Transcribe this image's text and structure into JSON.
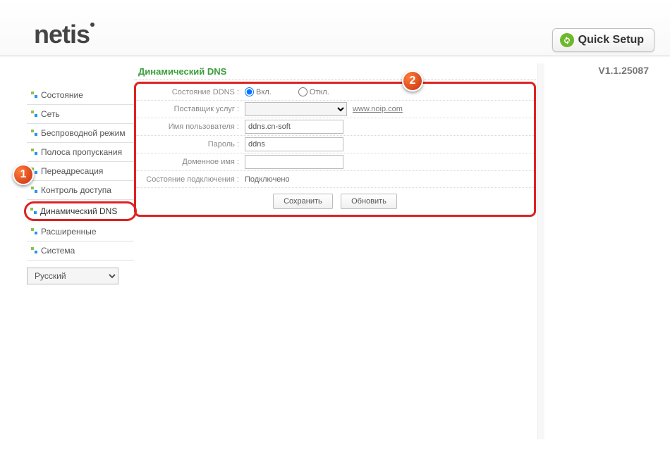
{
  "header": {
    "logo_text": "netis",
    "quick_setup": "Quick Setup"
  },
  "version": "V1.1.25087",
  "sidebar": {
    "items": [
      {
        "label": "Состояние"
      },
      {
        "label": "Сеть"
      },
      {
        "label": "Беспроводной режим"
      },
      {
        "label": "Полоса пропускания"
      },
      {
        "label": "Переадресация"
      },
      {
        "label": "Контроль доступа"
      },
      {
        "label": "Динамический DNS"
      },
      {
        "label": "Расширенные"
      },
      {
        "label": "Система"
      }
    ],
    "language": "Русский"
  },
  "form": {
    "title": "Динамический DNS",
    "labels": {
      "status": "Состояние DDNS :",
      "provider": "Поставщик услуг :",
      "username": "Имя пользователя :",
      "password": "Пароль :",
      "domain": "Доменное имя :",
      "conn_status": "Состояние подключения :"
    },
    "radio": {
      "on": "Вкл.",
      "off": "Откл."
    },
    "provider_link": "www.noip.com",
    "values": {
      "username": "ddns.cn-soft",
      "password": "ddns",
      "domain": "",
      "conn_status": "Подключено"
    },
    "buttons": {
      "save": "Сохранить",
      "refresh": "Обновить"
    }
  },
  "badges": {
    "one": "1",
    "two": "2"
  }
}
